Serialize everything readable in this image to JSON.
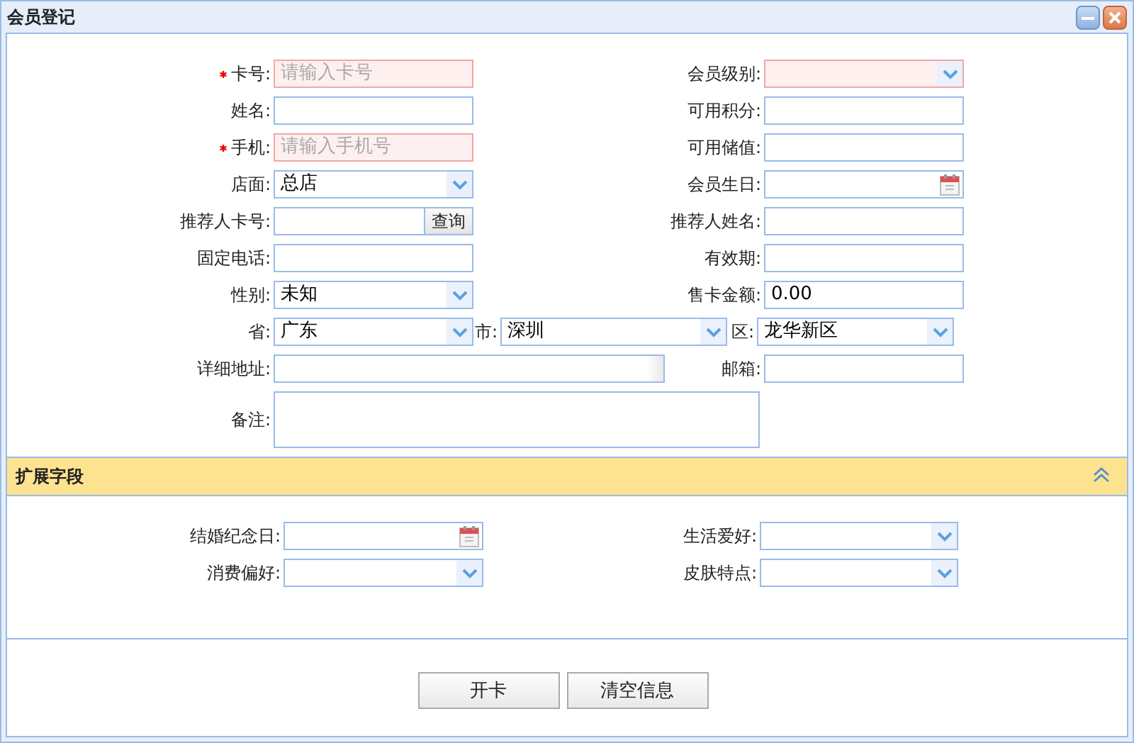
{
  "window": {
    "title": "会员登记"
  },
  "rows": [
    {
      "kind": "pair",
      "items": [
        {
          "label": "卡号:",
          "kind": "text",
          "placeholder": "请输入卡号",
          "required": true,
          "invalid": true
        },
        {
          "label": "会员级别:",
          "kind": "select",
          "required": false,
          "invalid": true
        }
      ]
    },
    {
      "kind": "pair",
      "items": [
        {
          "label": "姓名:",
          "kind": "text",
          "required": false,
          "invalid": false
        },
        {
          "label": "可用积分:",
          "kind": "text",
          "required": false,
          "invalid": false
        }
      ]
    },
    {
      "kind": "pair",
      "items": [
        {
          "label": "手机:",
          "kind": "text",
          "placeholder": "请输入手机号",
          "required": true,
          "invalid": true
        },
        {
          "label": "可用储值:",
          "kind": "text",
          "required": false,
          "invalid": false
        }
      ]
    },
    {
      "kind": "pair",
      "items": [
        {
          "label": "店面:",
          "kind": "select",
          "value": "总店",
          "required": false,
          "invalid": false
        },
        {
          "label": "会员生日:",
          "kind": "date",
          "required": false,
          "invalid": false
        }
      ]
    },
    {
      "kind": "pair",
      "items": [
        {
          "label": "推荐人卡号:",
          "kind": "lookup",
          "button": "查询",
          "required": false,
          "invalid": false
        },
        {
          "label": "推荐人姓名:",
          "kind": "text",
          "required": false,
          "invalid": false
        }
      ]
    },
    {
      "kind": "pair",
      "items": [
        {
          "label": "固定电话:",
          "kind": "text",
          "required": false,
          "invalid": false
        },
        {
          "label": "有效期:",
          "kind": "text",
          "required": false,
          "invalid": false
        }
      ]
    },
    {
      "kind": "pair",
      "items": [
        {
          "label": "性别:",
          "kind": "select",
          "value": "未知",
          "required": false,
          "invalid": false
        },
        {
          "label": "售卡金额:",
          "kind": "text",
          "value": "0.00",
          "required": false,
          "invalid": false
        }
      ]
    },
    {
      "kind": "region",
      "items": [
        {
          "label": "省:",
          "kind": "select",
          "value": "广东",
          "required": false,
          "invalid": false
        },
        {
          "label": "市:",
          "kind": "select",
          "value": "深圳",
          "required": false,
          "invalid": false
        },
        {
          "label": "区:",
          "kind": "select",
          "value": "龙华新区",
          "required": false,
          "invalid": false
        }
      ]
    },
    {
      "kind": "address",
      "items": [
        {
          "label": "详细地址:",
          "kind": "address",
          "required": false,
          "invalid": false
        },
        {
          "label": "邮箱:",
          "kind": "text",
          "required": false,
          "invalid": false
        }
      ]
    },
    {
      "kind": "remark",
      "items": [
        {
          "label": "备注:",
          "kind": "textarea",
          "required": false,
          "invalid": false
        }
      ]
    }
  ],
  "extension": {
    "title": "扩展字段",
    "expanded": true,
    "rows": [
      {
        "items": [
          {
            "label": "结婚纪念日:",
            "kind": "date"
          },
          {
            "label": "生活爱好:",
            "kind": "select"
          }
        ]
      },
      {
        "items": [
          {
            "label": "消费偏好:",
            "kind": "select"
          },
          {
            "label": "皮肤特点:",
            "kind": "select"
          }
        ]
      }
    ]
  },
  "buttons": [
    "开卡",
    "清空信息"
  ]
}
